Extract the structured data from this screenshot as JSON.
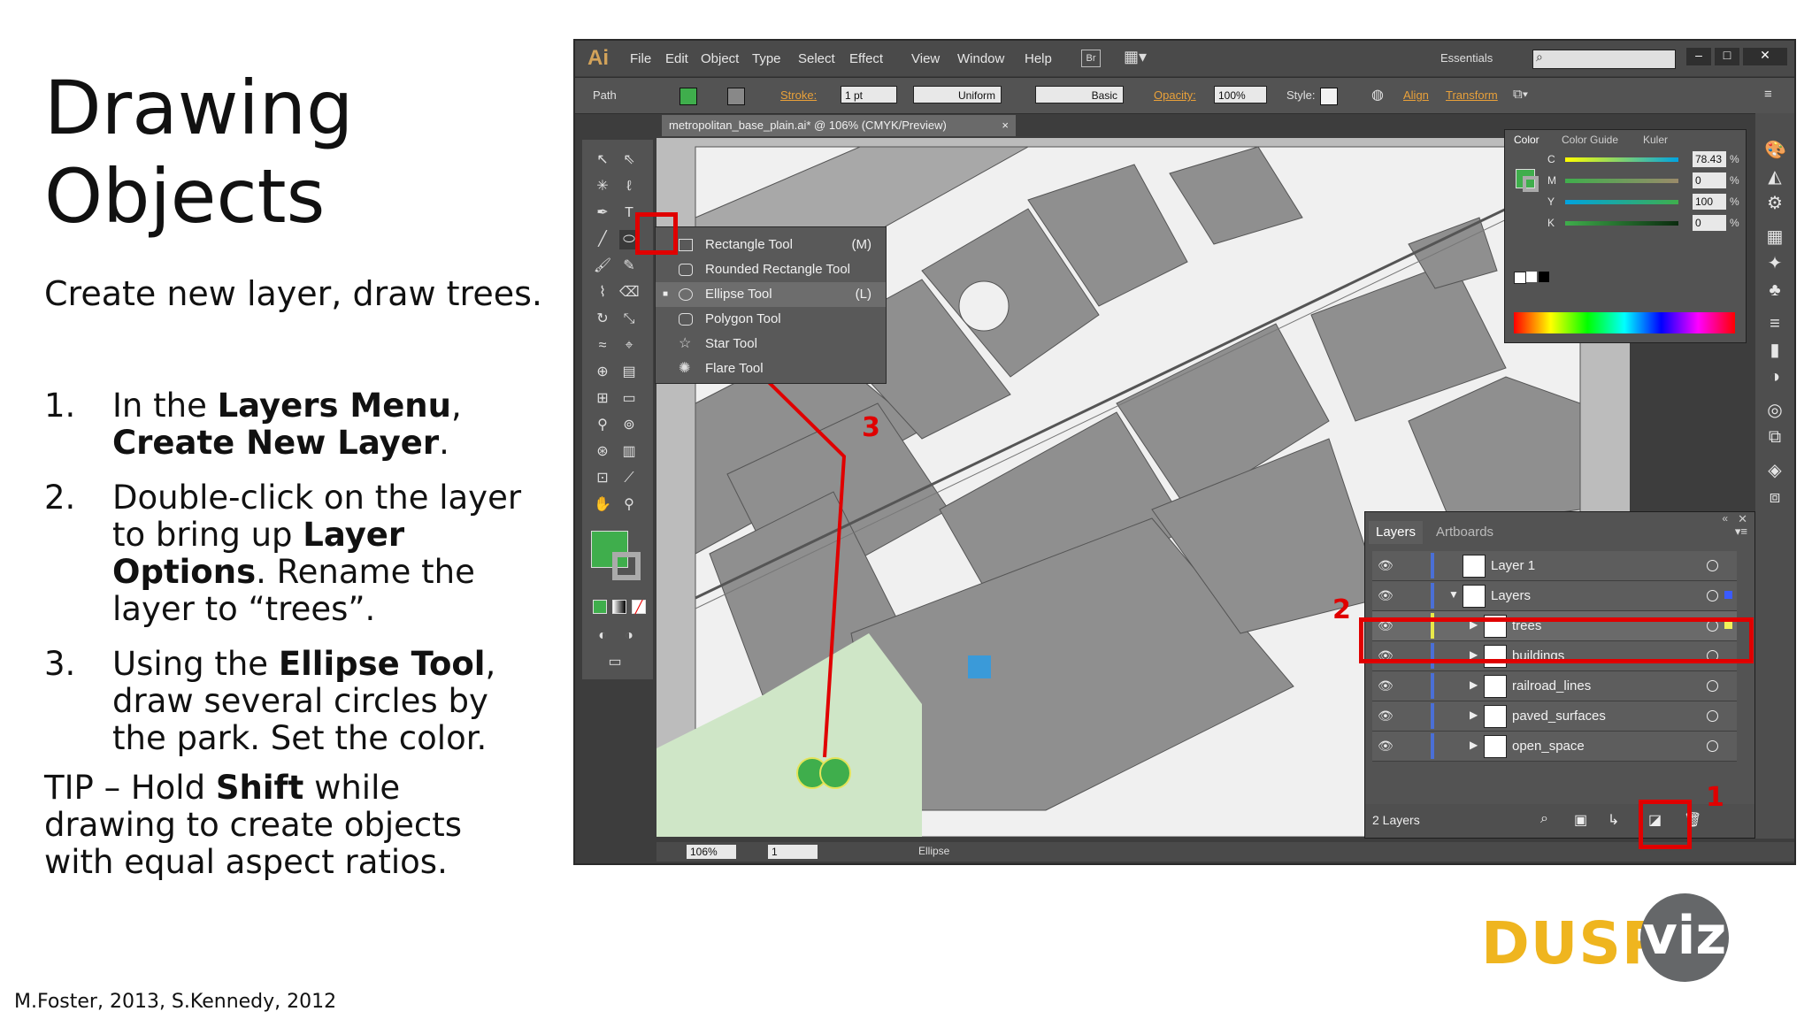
{
  "slide": {
    "title_line1": "Drawing",
    "title_line2": "Objects",
    "subtitle": "Create new layer, draw trees.",
    "steps": [
      {
        "num": "1.",
        "parts": [
          {
            "t": "In the ",
            "b": false
          },
          {
            "t": "Layers Menu",
            "b": true
          },
          {
            "t": ", ",
            "b": false
          },
          {
            "t": "Create New Layer",
            "b": true
          },
          {
            "t": ".",
            "b": false
          }
        ]
      },
      {
        "num": "2.",
        "parts": [
          {
            "t": "Double-click on the layer to bring up ",
            "b": false
          },
          {
            "t": "Layer Options",
            "b": true
          },
          {
            "t": ". Rename the layer to “trees”.",
            "b": false
          }
        ]
      },
      {
        "num": "3.",
        "parts": [
          {
            "t": "Using the ",
            "b": false
          },
          {
            "t": "Ellipse Tool",
            "b": true
          },
          {
            "t": ", draw several circles by the park. Set the color.",
            "b": false
          }
        ]
      }
    ],
    "tip_parts": [
      {
        "t": "TIP – Hold ",
        "b": false
      },
      {
        "t": "Shift",
        "b": true
      },
      {
        "t": " while drawing to create objects with equal aspect ratios.",
        "b": false
      }
    ],
    "credit": "M.Foster, 2013, S.Kennedy, 2012",
    "logo_left": "DUSP",
    "logo_right": "viz"
  },
  "app": {
    "logo": "Ai",
    "menu": [
      "File",
      "Edit",
      "Object",
      "Type",
      "Select",
      "Effect",
      "View",
      "Window",
      "Help"
    ],
    "bridge": "Br",
    "workspace": "Essentials",
    "window_controls": [
      "‒",
      "□",
      "✕"
    ],
    "control_bar": {
      "selection": "Path",
      "stroke_label": "Stroke:",
      "stroke_value": "1 pt",
      "profile": "Uniform",
      "brush": "Basic",
      "opacity_label": "Opacity:",
      "opacity_value": "100%",
      "style_label": "Style:",
      "align": "Align",
      "transform": "Transform"
    },
    "doc_tab": "metropolitan_base_plain.ai* @ 106% (CMYK/Preview)",
    "doc_tab_close": "×",
    "flyout": [
      {
        "label": "Rectangle Tool",
        "key": "(M)"
      },
      {
        "label": "Rounded Rectangle Tool",
        "key": ""
      },
      {
        "label": "Ellipse Tool",
        "key": "(L)"
      },
      {
        "label": "Polygon Tool",
        "key": ""
      },
      {
        "label": "Star Tool",
        "key": ""
      },
      {
        "label": "Flare Tool",
        "key": ""
      }
    ],
    "color_panel": {
      "tabs": [
        "Color",
        "Color Guide",
        "Kuler"
      ],
      "channels": [
        {
          "ch": "C",
          "value": "78.43",
          "color": "#00a3e0"
        },
        {
          "ch": "M",
          "value": "0",
          "color": "#e0006e"
        },
        {
          "ch": "Y",
          "value": "100",
          "color": "#f5e000"
        },
        {
          "ch": "K",
          "value": "0",
          "color": "#222222"
        }
      ],
      "fill_color": "#3fae4c"
    },
    "layers_panel": {
      "tabs": [
        "Layers",
        "Artboards"
      ],
      "rows": [
        {
          "name": "Layer 1",
          "indent": 0,
          "expanded": "",
          "bar_color": "#4a6fd6",
          "sq_color": ""
        },
        {
          "name": "Layers",
          "indent": 0,
          "expanded": "▼",
          "bar_color": "#4a6fd6",
          "sq_color": "#3b5bff"
        },
        {
          "name": "trees",
          "indent": 1,
          "expanded": "▶",
          "bar_color": "#e8e84a",
          "sq_color": "#f2f25a"
        },
        {
          "name": "buildings",
          "indent": 1,
          "expanded": "▶",
          "bar_color": "#4a6fd6",
          "sq_color": ""
        },
        {
          "name": "railroad_lines",
          "indent": 1,
          "expanded": "▶",
          "bar_color": "#4a6fd6",
          "sq_color": ""
        },
        {
          "name": "paved_surfaces",
          "indent": 1,
          "expanded": "▶",
          "bar_color": "#4a6fd6",
          "sq_color": ""
        },
        {
          "name": "open_space",
          "indent": 1,
          "expanded": "▶",
          "bar_color": "#4a6fd6",
          "sq_color": ""
        }
      ],
      "footer_count": "2 Layers"
    },
    "status": {
      "zoom": "106%",
      "artboard": "1",
      "tool": "Ellipse"
    },
    "annotations": [
      "1",
      "2",
      "3"
    ]
  }
}
